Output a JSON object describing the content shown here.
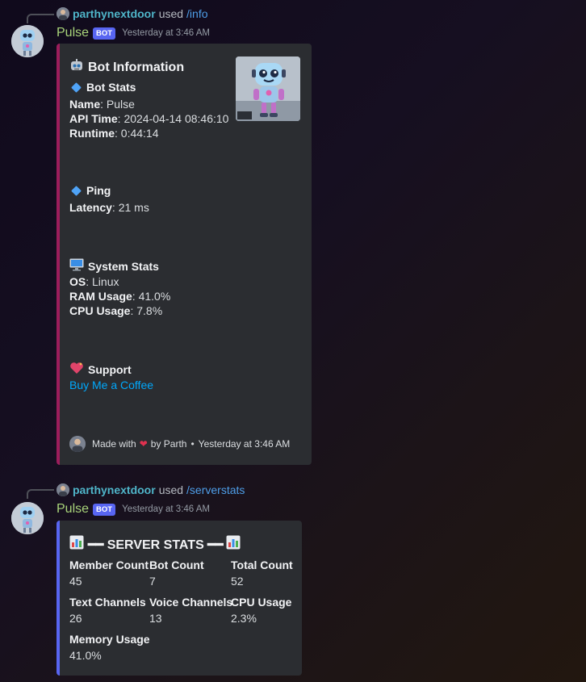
{
  "messages": [
    {
      "reply_user": "parthynextdoor",
      "reply_used": "used",
      "reply_command": "/info",
      "username": "Pulse",
      "bot_tag": "BOT",
      "timestamp": "Yesterday at 3:46 AM",
      "embed": {
        "accent_color": "#9c1d5c",
        "title": "Bot Information",
        "title_icon": "robot-face-icon",
        "bot_stats_heading": "Bot Stats",
        "name_label": "Name",
        "name_value": "Pulse",
        "api_time_label": "API Time",
        "api_time_value": "2024-04-14 08:46:10",
        "runtime_label": "Runtime",
        "runtime_value": "0:44:14",
        "ping_heading": "Ping",
        "latency_label": "Latency",
        "latency_value": "21 ms",
        "system_heading": "System Stats",
        "os_label": "OS",
        "os_value": "Linux",
        "ram_label": "RAM Usage",
        "ram_value": "41.0%",
        "cpu_label": "CPU Usage",
        "cpu_value": "7.8%",
        "support_heading": "Support",
        "support_link": "Buy Me a Coffee",
        "footer_made_with": "Made with",
        "footer_by": "by Parth",
        "footer_sep": "•",
        "footer_time": "Yesterday at 3:46 AM"
      }
    },
    {
      "reply_user": "parthynextdoor",
      "reply_used": "used",
      "reply_command": "/serverstats",
      "username": "Pulse",
      "bot_tag": "BOT",
      "timestamp": "Yesterday at 3:46 AM",
      "embed": {
        "accent_color": "#5865f2",
        "title": "━━ SERVER STATS ━━",
        "title_icon": "bar-chart-icon",
        "fields": [
          {
            "name": "Member Count",
            "value": "45"
          },
          {
            "name": "Bot Count",
            "value": "7"
          },
          {
            "name": "Total Count",
            "value": "52"
          },
          {
            "name": "Text Channels",
            "value": "26"
          },
          {
            "name": "Voice Channels",
            "value": "13"
          },
          {
            "name": "CPU Usage",
            "value": "2.3%"
          },
          {
            "name": "Memory Usage",
            "value": "41.0%"
          }
        ]
      }
    }
  ]
}
